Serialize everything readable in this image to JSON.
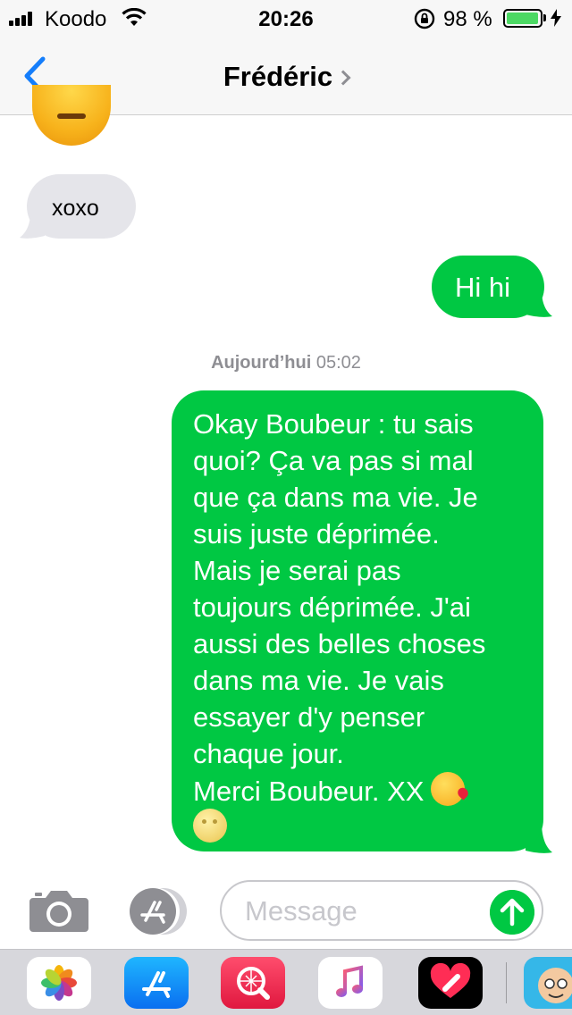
{
  "status_bar": {
    "carrier": "Koodo",
    "time": "20:26",
    "battery_percent": "98 %",
    "battery_level": 0.98
  },
  "nav": {
    "contact_name": "Frédéric"
  },
  "messages": {
    "incoming_1": "xoxo",
    "outgoing_1": "Hi hi",
    "timestamp_day": "Aujourd’hui",
    "timestamp_time": "05:02",
    "outgoing_2_lines": [
      "Okay Boubeur : tu sais",
      "quoi? Ça va pas si mal",
      "que ça dans ma vie. Je",
      "suis juste déprimée.",
      "Mais je serai pas",
      "toujours déprimée. J'ai",
      "aussi des belles choses",
      "dans ma vie. Je vais",
      "essayer d'y penser",
      "chaque jour.",
      "Merci Boubeur. XX"
    ]
  },
  "input": {
    "placeholder": "Message"
  },
  "colors": {
    "outgoing_bubble": "#00c843",
    "incoming_bubble": "#e5e5ea",
    "accent_blue": "#157efb"
  },
  "app_drawer": {
    "apps": [
      "photos-icon",
      "app-store-icon",
      "web-search-icon",
      "music-icon",
      "digital-touch-icon",
      "memoji-icon"
    ]
  }
}
